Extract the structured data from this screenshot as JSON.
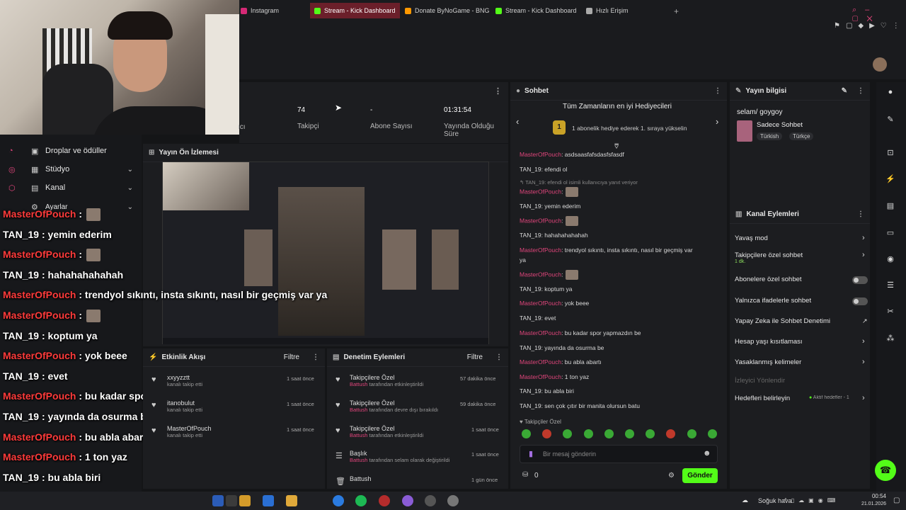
{
  "browser": {
    "tabs": [
      {
        "label": "Instagram",
        "color": "#d62976",
        "active": false
      },
      {
        "label": "Stream - Kick Dashboard",
        "color": "#53fc18",
        "active": true
      },
      {
        "label": "Donate ByNoGame - BNG",
        "color": "#ff9900",
        "active": false
      },
      {
        "label": "Stream - Kick Dashboard",
        "color": "#53fc18",
        "active": false
      },
      {
        "label": "Hızlı Erişim",
        "color": "#aaaaaa",
        "active": false
      }
    ]
  },
  "left_nav": {
    "items": [
      {
        "label": "Droplar ve ödüller"
      },
      {
        "label": "Stüdyo"
      },
      {
        "label": "Kanal"
      },
      {
        "label": "Ayarlar"
      }
    ]
  },
  "stats": [
    {
      "value": "74",
      "label": "Takipçi"
    },
    {
      "value": "-",
      "label": "Abone Sayısı"
    },
    {
      "value": "01:31:54",
      "label": "Yayında Olduğu Süre"
    }
  ],
  "stat_partial": "ıcı",
  "preview": {
    "title": "Yayın Ön İzlemesi"
  },
  "overlay_chat": [
    {
      "user": "MasterOfPouch",
      "text": ":",
      "kind": "u1",
      "img": true
    },
    {
      "user": "TAN_19",
      "text": ": yemin ederim",
      "kind": "u2"
    },
    {
      "user": "MasterOfPouch",
      "text": ":",
      "kind": "u1",
      "img": true
    },
    {
      "user": "TAN_19",
      "text": ": hahahahahahah",
      "kind": "u2"
    },
    {
      "user": "MasterOfPouch",
      "text": ": trendyol sıkıntı, insta sıkıntı, nasıl bir geçmiş var ya",
      "kind": "u1"
    },
    {
      "user": "MasterOfPouch",
      "text": ":",
      "kind": "u1",
      "img": true
    },
    {
      "user": "TAN_19",
      "text": ": koptum ya",
      "kind": "u2"
    },
    {
      "user": "MasterOfPouch",
      "text": ": yok beee",
      "kind": "u1"
    },
    {
      "user": "TAN_19",
      "text": ": evet",
      "kind": "u2"
    },
    {
      "user": "MasterOfPouch",
      "text": ": bu kadar spor yapmazdın be",
      "kind": "u1"
    },
    {
      "user": "TAN_19",
      "text": ": yayında da osurma be",
      "kind": "u2"
    },
    {
      "user": "MasterOfPouch",
      "text": ": bu abla abartı",
      "kind": "u1"
    },
    {
      "user": "MasterOfPouch",
      "text": ": 1 ton yaz",
      "kind": "u1"
    },
    {
      "user": "TAN_19",
      "text": ": bu abla biri",
      "kind": "u2"
    },
    {
      "user": "TAN_19",
      "text": ": sen çok çıtır bir manita olursun batu",
      "kind": "u2"
    }
  ],
  "activity": {
    "title": "Etkinlik Akışı",
    "filter": "Filtre",
    "items": [
      {
        "name": "xxyyzztt",
        "sub": "kanalı takip etti",
        "time": "1 saat önce"
      },
      {
        "name": "itanobulut",
        "sub": "kanalı takip etti",
        "time": "1 saat önce"
      },
      {
        "name": "MasterOfPouch",
        "sub": "kanalı takip etti",
        "time": "1 saat önce"
      }
    ]
  },
  "moderation": {
    "title": "Denetim Eylemleri",
    "filter": "Filtre",
    "items": [
      {
        "name": "Takipçilere Özel",
        "actor": "Battush",
        "sub": "tarafından etkinleştirildi",
        "time": "57 dakika önce"
      },
      {
        "name": "Takipçilere Özel",
        "actor": "Battush",
        "sub": "tarafından devre dışı bırakıldı",
        "time": "59 dakika önce"
      },
      {
        "name": "Takipçilere Özel",
        "actor": "Battush",
        "sub": "tarafından etkinleştirildi",
        "time": "1 saat önce"
      },
      {
        "name": "Başlık",
        "actor": "Battush",
        "sub": "tarafından selam olarak değiştirildi",
        "time": "1 saat önce"
      },
      {
        "name": "Battush",
        "actor": "",
        "sub": "",
        "time": "1 gün önce"
      }
    ]
  },
  "chat": {
    "title": "Sohbet",
    "gifters_title": "Tüm Zamanların en iyi Hediyecileri",
    "gifters_sub": "1 abonelik hediye ederek 1. sıraya yükselin",
    "rank": "1",
    "reply_note": "TAN_19: efendi ol isimli kullanıcıya yanıt veriyor",
    "messages": [
      {
        "user": "MasterOfPouch",
        "text": ": asdsaasfafsdasfsfasdf",
        "c": "n1"
      },
      {
        "user": "TAN_19",
        "text": ": efendi ol",
        "c": "n2"
      },
      {
        "user": "MasterOfPouch",
        "text": ":",
        "c": "n1",
        "img": true
      },
      {
        "user": "TAN_19",
        "text": ": yemin ederim",
        "c": "n2"
      },
      {
        "user": "MasterOfPouch",
        "text": ":",
        "c": "n1",
        "img": true
      },
      {
        "user": "TAN_19",
        "text": ": hahahahahahah",
        "c": "n2"
      },
      {
        "user": "MasterOfPouch",
        "text": ": trendyol sıkıntı, insta sıkıntı, nasıl bir geçmiş var",
        "c": "n1"
      },
      {
        "user": "",
        "text": "ya",
        "c": "n2"
      },
      {
        "user": "MasterOfPouch",
        "text": ":",
        "c": "n1",
        "img": true
      },
      {
        "user": "TAN_19",
        "text": ": koptum ya",
        "c": "n2"
      },
      {
        "user": "MasterOfPouch",
        "text": ": yok beee",
        "c": "n1"
      },
      {
        "user": "TAN_19",
        "text": ": evet",
        "c": "n2"
      },
      {
        "user": "MasterOfPouch",
        "text": ": bu kadar spor yapmazdın be",
        "c": "n1"
      },
      {
        "user": "TAN_19",
        "text": ": yayında da osurma be",
        "c": "n2"
      },
      {
        "user": "MasterOfPouch",
        "text": ": bu abla abartı",
        "c": "n1"
      },
      {
        "user": "MasterOfPouch",
        "text": ": 1 ton yaz",
        "c": "n1"
      },
      {
        "user": "TAN_19",
        "text": ": bu abla biri",
        "c": "n2"
      },
      {
        "user": "TAN_19",
        "text": ": sen çok çıtır bir manita olursun batu",
        "c": "n2"
      }
    ],
    "mode_note": "Takipçiler Özel",
    "input_placeholder": "Bir mesaj gönderin",
    "points": "0",
    "send": "Gönder"
  },
  "stream_info": {
    "title": "Yayın bilgisi",
    "stream_title": "selam/ goygoy",
    "category": "Sadece Sohbet",
    "tags": [
      "Türkish",
      "Türkçe"
    ]
  },
  "channel_actions": {
    "title": "Kanal Eylemleri",
    "items": [
      {
        "label": "Yavaş mod",
        "control": "chevron"
      },
      {
        "label": "Takipçilere özel sohbet",
        "sub": "1 dk.",
        "control": "chevron"
      },
      {
        "label": "Abonelere özel sohbet",
        "control": "toggle"
      },
      {
        "label": "Yalnızca ifadelerle sohbet",
        "control": "toggle"
      },
      {
        "label": "Yapay Zeka ile Sohbet Denetimi",
        "control": "external"
      },
      {
        "label": "Hesap yaşı kısıtlaması",
        "control": "chevron"
      },
      {
        "label": "Yasaklanmış kelimeler",
        "control": "chevron"
      },
      {
        "label": "İzleyici Yönlendir",
        "control": "none",
        "muted": true
      },
      {
        "label": "Hedefleri belirleyin",
        "control": "chevron",
        "badge": "Aktif hedefler - 1"
      }
    ]
  },
  "taskbar": {
    "weather": "Soğuk hava",
    "time": "00:54",
    "date": "21.01.2026"
  }
}
